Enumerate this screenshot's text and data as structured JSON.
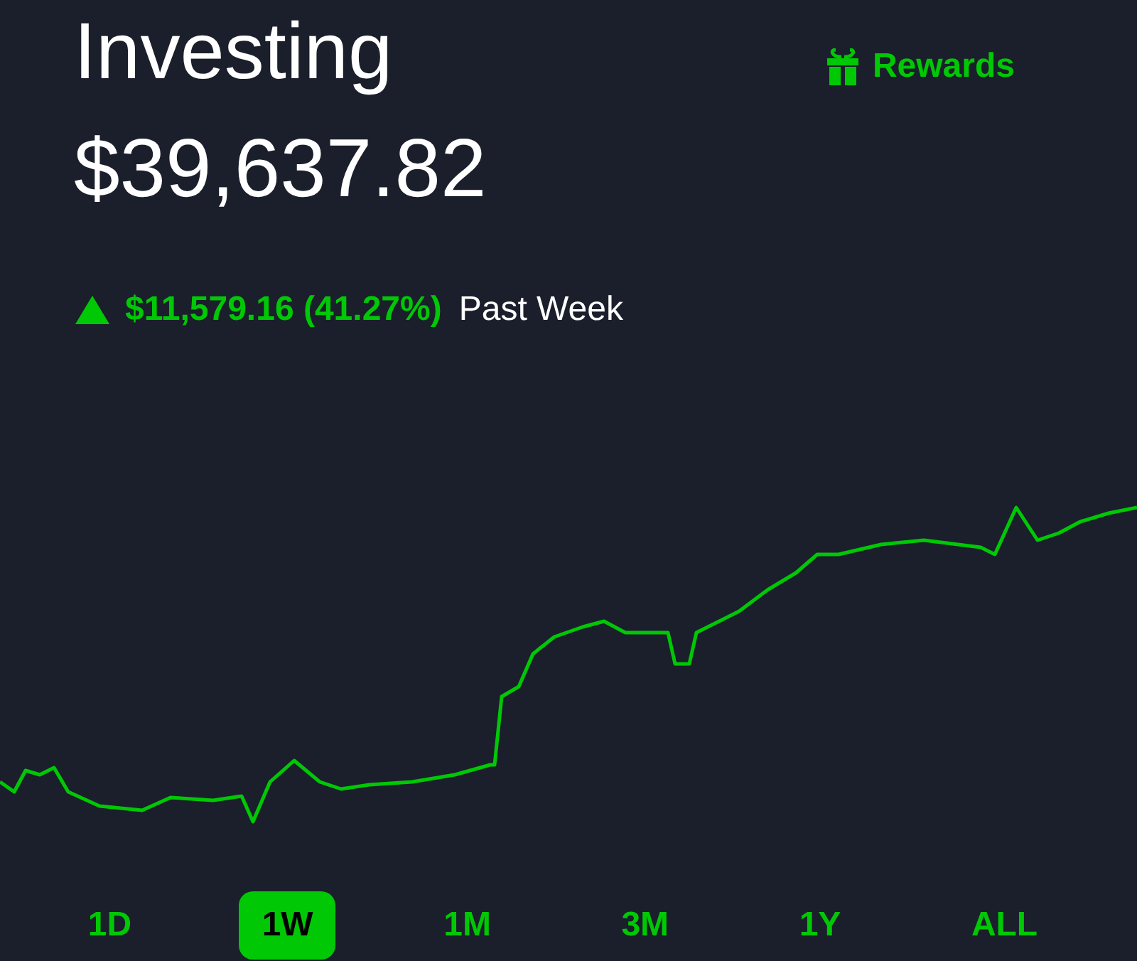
{
  "header": {
    "title": "Investing",
    "rewards": "Rewards"
  },
  "portfolio": {
    "value": "$39,637.82",
    "rising": true,
    "change": "$11,579.16 (41.27%)",
    "period": "Past Week"
  },
  "ranges": [
    {
      "label": "1D",
      "selected": false
    },
    {
      "label": "1W",
      "selected": true
    },
    {
      "label": "1M",
      "selected": false
    },
    {
      "label": "3M",
      "selected": false
    },
    {
      "label": "1Y",
      "selected": false
    },
    {
      "label": "ALL",
      "selected": false
    }
  ]
}
